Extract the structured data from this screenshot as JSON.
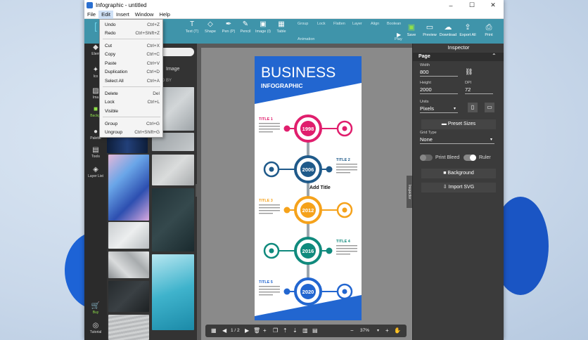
{
  "window": {
    "title": "Infographic - untitled"
  },
  "menu": {
    "items": [
      "File",
      "Edit",
      "Insert",
      "Window",
      "Help"
    ]
  },
  "edit_menu": [
    {
      "label": "Undo",
      "shortcut": "Ctrl+Z"
    },
    {
      "label": "Redo",
      "shortcut": "Ctrl+Shift+Z"
    },
    {
      "label": "Cut",
      "shortcut": "Ctrl+X"
    },
    {
      "label": "Copy",
      "shortcut": "Ctrl+C"
    },
    {
      "label": "Paste",
      "shortcut": "Ctrl+V"
    },
    {
      "label": "Duplication",
      "shortcut": "Ctrl+D"
    },
    {
      "label": "Select All",
      "shortcut": "Ctrl+A"
    },
    {
      "label": "Delete",
      "shortcut": "Del"
    },
    {
      "label": "Lock",
      "shortcut": "Ctrl+L"
    },
    {
      "label": "Visible",
      "shortcut": ""
    },
    {
      "label": "Group",
      "shortcut": "Ctrl+G"
    },
    {
      "label": "Ungroup",
      "shortcut": "Ctrl+Shift+G"
    }
  ],
  "toolbar": {
    "tools": [
      "Text (T)",
      "Shape",
      "Pen (P)",
      "Pencil",
      "Image (I)",
      "Table"
    ],
    "groups": [
      "Group",
      "Lock",
      "Flatten",
      "Layer",
      "Align",
      "Boolean"
    ],
    "sublabels": {
      "animation": "Animation",
      "play": "Play"
    },
    "right": [
      "Save",
      "Preview",
      "Download",
      "Export All",
      "Print"
    ]
  },
  "leftbar": {
    "items": [
      "Elements",
      "Icons",
      "Images",
      "Backgrounds",
      "Palette",
      "Tools",
      "Layer List",
      "Buy",
      "Tutorial"
    ],
    "visible_labels": [
      "Elem",
      "Ico",
      "Ima",
      "Backgr",
      "Palette",
      "Tools",
      "Layer List",
      "Buy",
      "Tutorial"
    ]
  },
  "leftpanel": {
    "tab": "Image",
    "credit": "D BY"
  },
  "canvas": {
    "zoom": "37%",
    "page_indicator": "1 / 2",
    "float_label": "Add Title"
  },
  "infographic": {
    "title": "BUSINESS",
    "subtitle": "INFOGRAPHIC",
    "milestones": [
      {
        "year": "1998",
        "title": "TITLE 1",
        "color": "#e01e6d",
        "side": "left"
      },
      {
        "year": "2006",
        "title": "TITLE 2",
        "color": "#1f5a8a",
        "side": "right"
      },
      {
        "year": "2012",
        "title": "TITLE 3",
        "color": "#f5a21b",
        "side": "left"
      },
      {
        "year": "2016",
        "title": "TITLE 4",
        "color": "#108a7d",
        "side": "right"
      },
      {
        "year": "2020",
        "title": "TITLE 5",
        "color": "#2266d0",
        "side": "left"
      }
    ],
    "colors": {
      "blue": "#2266d0",
      "spine": "#9aa5ad"
    }
  },
  "inspector": {
    "title": "Inspector",
    "section": "Page",
    "width_label": "Width",
    "width": "800",
    "height_label": "Height",
    "height": "2000",
    "dpi_label": "DPI",
    "dpi": "72",
    "units_label": "Units",
    "units": "Pixels",
    "preset_label": "Preset Sizes",
    "grid_label": "Grid Type",
    "grid": "None",
    "print_bleed": "Print Bleed",
    "ruler": "Ruler",
    "background": "Background",
    "import_svg": "Import SVG"
  },
  "side_tab": "Inspector",
  "colors": {
    "toolbar": "#3f94aa",
    "accent_green": "#6cc24a",
    "dark": "#3b3b3b"
  }
}
